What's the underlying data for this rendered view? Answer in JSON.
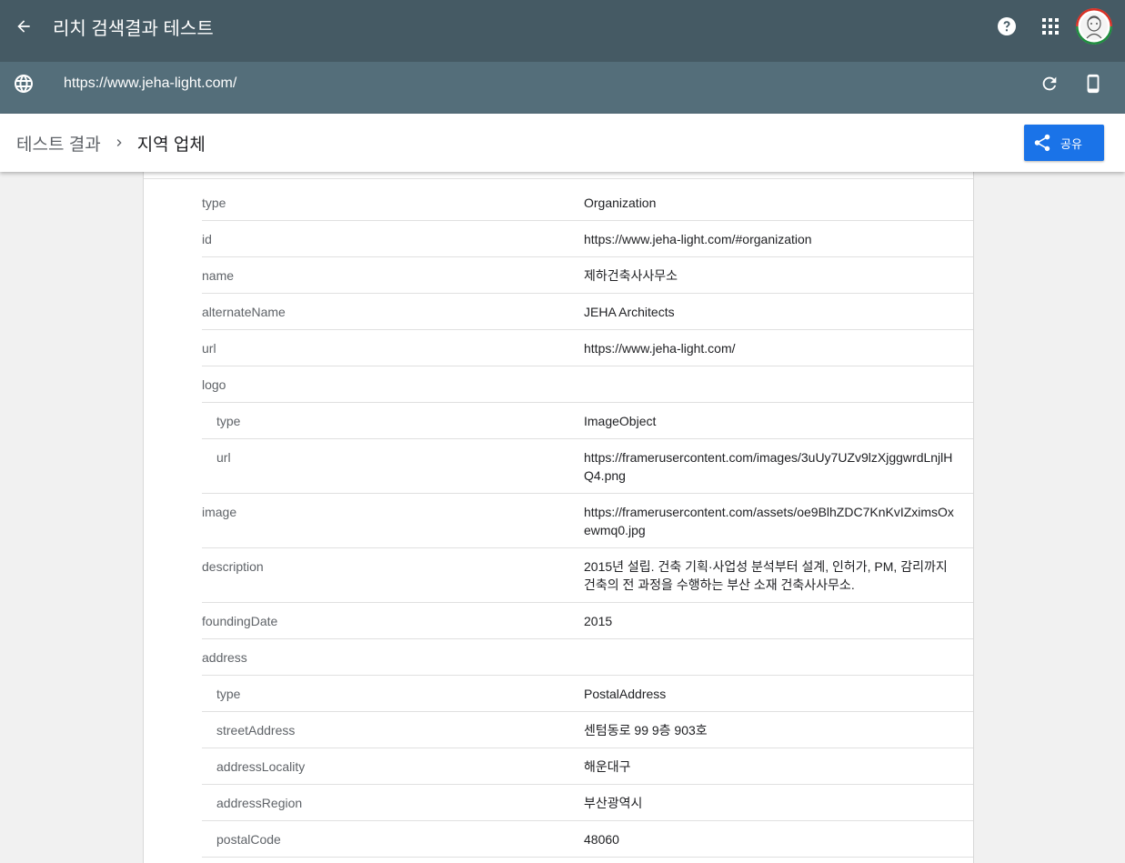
{
  "appbar": {
    "title": "리치 검색결과 테스트"
  },
  "urlbar": {
    "url": "https://www.jeha-light.com/"
  },
  "breadcrumb": {
    "root": "테스트 결과",
    "current": "지역 업체"
  },
  "share": {
    "label": "공유"
  },
  "colors": {
    "appbar": "#455a64",
    "urlbar": "#546e7a",
    "accent": "#1a73e8"
  },
  "rows": [
    {
      "key": "type",
      "value": "Organization",
      "nested": false
    },
    {
      "key": "id",
      "value": "https://www.jeha-light.com/#organization",
      "nested": false
    },
    {
      "key": "name",
      "value": "제하건축사사무소",
      "nested": false
    },
    {
      "key": "alternateName",
      "value": "JEHA Architects",
      "nested": false
    },
    {
      "key": "url",
      "value": "https://www.jeha-light.com/",
      "nested": false
    },
    {
      "key": "logo",
      "value": "",
      "nested": false
    },
    {
      "key": "type",
      "value": "ImageObject",
      "nested": true
    },
    {
      "key": "url",
      "value": "https://framerusercontent.com/images/3uUy7UZv9lzXjggwrdLnjlHQ4.png",
      "nested": true
    },
    {
      "key": "image",
      "value": "https://framerusercontent.com/assets/oe9BlhZDC7KnKvIZximsOxewmq0.jpg",
      "nested": false
    },
    {
      "key": "description",
      "value": "2015년 설립. 건축 기획·사업성 분석부터 설계, 인허가, PM, 감리까지 건축의 전 과정을 수행하는 부산 소재 건축사사무소.",
      "nested": false
    },
    {
      "key": "foundingDate",
      "value": "2015",
      "nested": false
    },
    {
      "key": "address",
      "value": "",
      "nested": false
    },
    {
      "key": "type",
      "value": "PostalAddress",
      "nested": true
    },
    {
      "key": "streetAddress",
      "value": "센텀동로 99 9층 903호",
      "nested": true
    },
    {
      "key": "addressLocality",
      "value": "해운대구",
      "nested": true
    },
    {
      "key": "addressRegion",
      "value": "부산광역시",
      "nested": true
    },
    {
      "key": "postalCode",
      "value": "48060",
      "nested": true
    }
  ]
}
